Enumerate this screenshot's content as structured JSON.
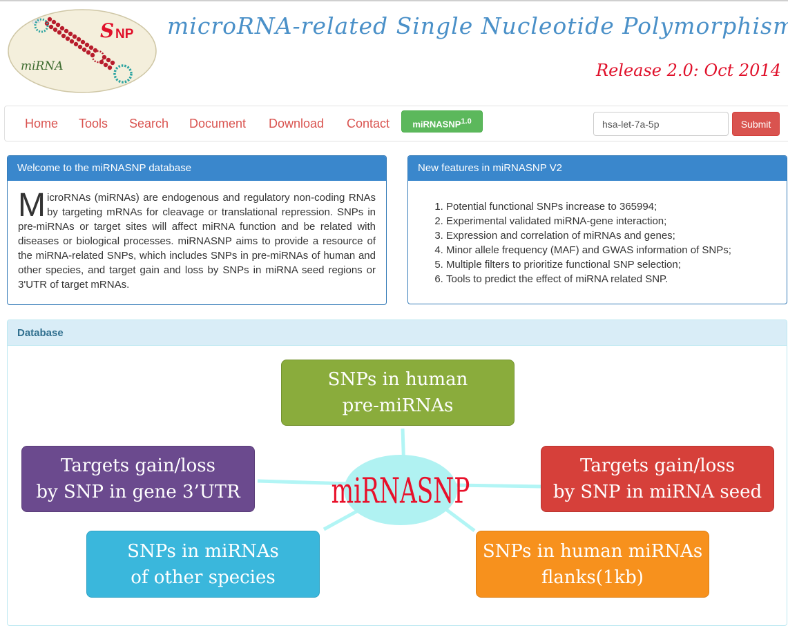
{
  "header": {
    "logo_snp_text": "SNP",
    "logo_mirna_text": "miRNA",
    "title": "microRNA-related Single Nucleotide Polymorphisms",
    "release": "Release 2.0: Oct 2014"
  },
  "nav": {
    "items": [
      "Home",
      "Tools",
      "Search",
      "Document",
      "Download",
      "Contact"
    ],
    "brand_label": "miRNASNP",
    "brand_version": "1.0",
    "search_value": "hsa-let-7a-5p",
    "submit_label": "Submit"
  },
  "welcome": {
    "heading": "Welcome to the miRNASNP database",
    "dropcap": "M",
    "text": "icroRNAs (miRNAs) are endogenous and regulatory non-coding RNAs by targeting mRNAs for cleavage or translational repression. SNPs in pre-miRNAs or target sites will affect miRNA function and be related with diseases or biological processes. miRNASNP aims to provide a resource of the miRNA-related SNPs, which includes SNPs in pre-miRNAs of human and other species, and target gain and loss by SNPs in miRNA seed regions or 3'UTR of target mRNAs."
  },
  "features": {
    "heading": "New features in miRNASNP V2",
    "items": [
      "Potential functional SNPs increase to 365994;",
      "Experimental validated miRNA-gene interaction;",
      "Expression and correlation of miRNAs and genes;",
      "Minor allele frequency (MAF) and GWAS information of SNPs;",
      "Multiple filters to prioritize functional SNP selection;",
      "Tools to predict the effect of miRNA related SNP."
    ]
  },
  "database": {
    "heading": "Database",
    "center_label": "miRNASNP",
    "boxes": {
      "pre_mirnas": [
        "SNPs in human",
        "pre-miRNAs"
      ],
      "gene_utr": [
        "Targets gain/loss",
        "by SNP in gene 3’UTR"
      ],
      "mirna_seed": [
        "Targets gain/loss",
        "by SNP in miRNA seed"
      ],
      "other_species": [
        "SNPs in miRNAs",
        "of other species"
      ],
      "flanks": [
        "SNPs in human miRNAs",
        "flanks(1kb)"
      ]
    }
  },
  "colors": {
    "nav_link": "#d9534f",
    "title_blue": "#4a90c8",
    "release_red": "#e0102a",
    "panel_blue": "#3a87cc",
    "box_green": "#8aac3c",
    "box_purple": "#6b4a8e",
    "box_red": "#d6403a",
    "box_cyan": "#3ab7dc",
    "box_orange": "#f7911d",
    "center_ellipse": "#b0f2f2",
    "center_text": "#e8102a"
  }
}
